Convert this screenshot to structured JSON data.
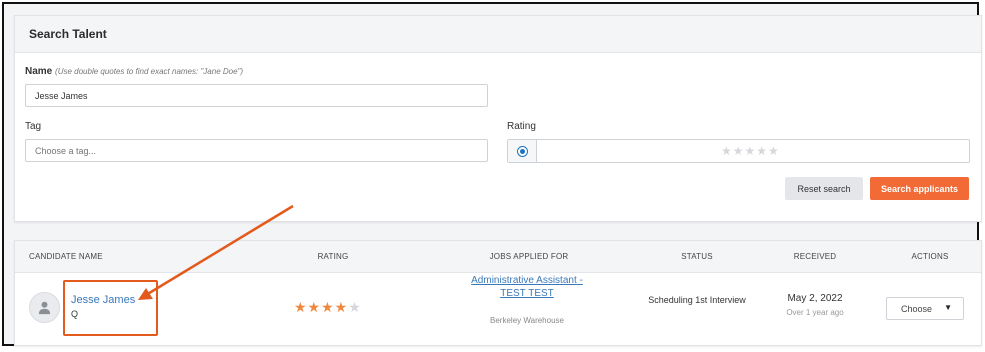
{
  "search": {
    "title": "Search Talent",
    "name_label": "Name",
    "name_hint": "(Use double quotes to find exact names: \"Jane Doe\")",
    "name_value": "Jesse James",
    "tag_label": "Tag",
    "tag_placeholder": "Choose a tag...",
    "rating_label": "Rating",
    "rating_empty_stars": "★★★★★",
    "reset_label": "Reset search",
    "submit_label": "Search applicants"
  },
  "table": {
    "headers": {
      "candidate": "CANDIDATE NAME",
      "rating": "RATING",
      "jobs": "JOBS APPLIED FOR",
      "status": "STATUS",
      "received": "RECEIVED",
      "actions": "ACTIONS"
    },
    "rows": [
      {
        "name": "Jesse James",
        "search_glyph": "Q",
        "rating": 4,
        "rating_max": 5,
        "stars_on": "★★★★",
        "stars_off": "★",
        "job_title": "Administrative Assistant - TEST TEST",
        "job_location": "Berkeley Warehouse",
        "status": "Scheduling 1st Interview",
        "received_date": "May 2, 2022",
        "received_ago": "Over 1 year ago",
        "action_label": "Choose",
        "action_caret": "▼"
      }
    ]
  },
  "colors": {
    "accent_orange": "#f26a36",
    "annotation_orange": "#e25a1c",
    "link_blue": "#3a78b9",
    "star_on": "#f0883e",
    "star_off": "#d5d7db"
  },
  "icons": [
    "person-icon",
    "search-icon",
    "caret-down-icon",
    "radio-icon",
    "star-icon"
  ]
}
